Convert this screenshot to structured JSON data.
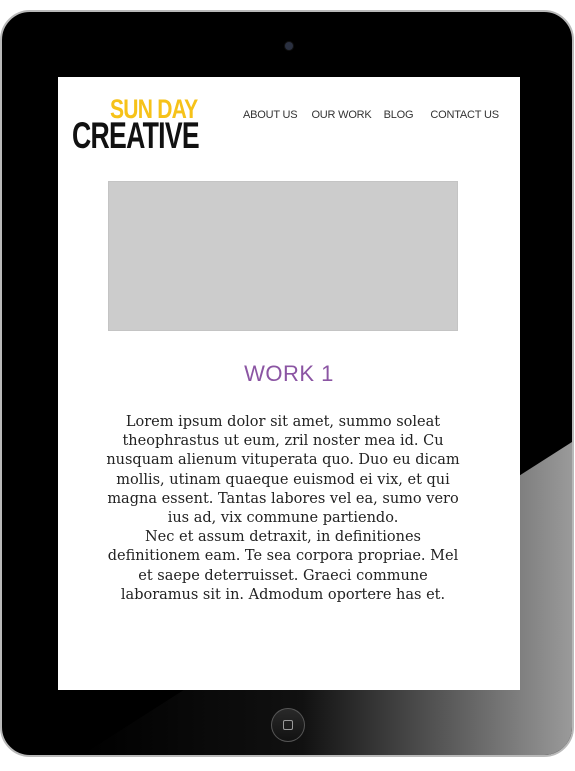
{
  "logo": {
    "line1": "SUN DAY",
    "line2": "CREATIVE"
  },
  "nav": {
    "items": [
      "ABOUT US",
      "OUR WORK",
      "BLOG",
      "CONTACT US"
    ]
  },
  "work": {
    "title": "WORK 1",
    "paragraph1": "Lorem ipsum dolor sit amet, summo soleat theophrastus ut eum, zril noster mea id. Cu nusquam alienum vituperata quo. Duo eu dicam mollis, utinam quaeque euismod ei vix, et qui magna essent. Tantas labores vel ea, sumo vero ius ad, vix commune partiendo.",
    "paragraph2": "Nec et assum detraxit, in definitiones definitionem eam. Te sea corpora propriae. Mel et saepe deterruisset. Graeci commune laboramus sit in. Admodum oportere has et."
  },
  "colors": {
    "accent": "#8b55a3",
    "logo_yellow": "#f6c219",
    "placeholder_gray": "#cccccc"
  }
}
